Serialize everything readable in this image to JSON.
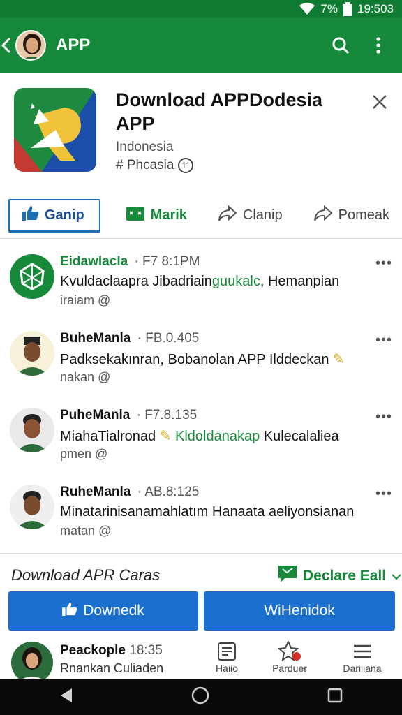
{
  "status_bar": {
    "battery": "7%",
    "time": "19:503"
  },
  "app_bar": {
    "title": "APP"
  },
  "app_header": {
    "name": "Download APPDodesia APP",
    "country": "Indonesia",
    "tag": "# Phcasia",
    "tag_badge": "11"
  },
  "tabs": [
    {
      "label": "Ganip"
    },
    {
      "label": "Marik"
    },
    {
      "label": "Clanip"
    },
    {
      "label": "Pomeak"
    }
  ],
  "feed": [
    {
      "name": "Eidawlacla",
      "time": "· F7 8:1PM",
      "text_before": "Kvuldaclaapra Jibadriain",
      "text_highlight": "guukalc",
      "text_after": ", Hemanpian",
      "sub": "iraiam"
    },
    {
      "name": "BuheManla",
      "time": "· FB.0.405",
      "text_before": "Padksekakınran, Bobanolan APP Ilddeckan",
      "text_highlight": "",
      "text_after": "",
      "sub": "nakan"
    },
    {
      "name": "PuheManla",
      "time": "· F7.8.135",
      "text_before": "MiahaTialronad",
      "text_highlight": "Kldoldanakap",
      "text_after": " Kulecalaliea",
      "sub": "pmen"
    },
    {
      "name": "RuheManla",
      "time": "· AB.8:125",
      "text_before": "Minatarinisanamahlatım Hanaata aeliyonsianan",
      "text_highlight": "",
      "text_after": "",
      "sub": "matan"
    }
  ],
  "bottom_panel": {
    "title": "Download APR Caras",
    "declare": "Declare Eall",
    "btn_left": "Downedk",
    "btn_right": "WiHenidok"
  },
  "bottom_row": {
    "name": "Peackople",
    "time": "18:35",
    "text": "Rnankan Culiaden",
    "nav": [
      {
        "label": "Haiio"
      },
      {
        "label": "Parduer"
      },
      {
        "label": "Dariiiana"
      }
    ]
  },
  "colors": {
    "primary_green": "#17893b",
    "accent_blue": "#1b6fcf"
  }
}
